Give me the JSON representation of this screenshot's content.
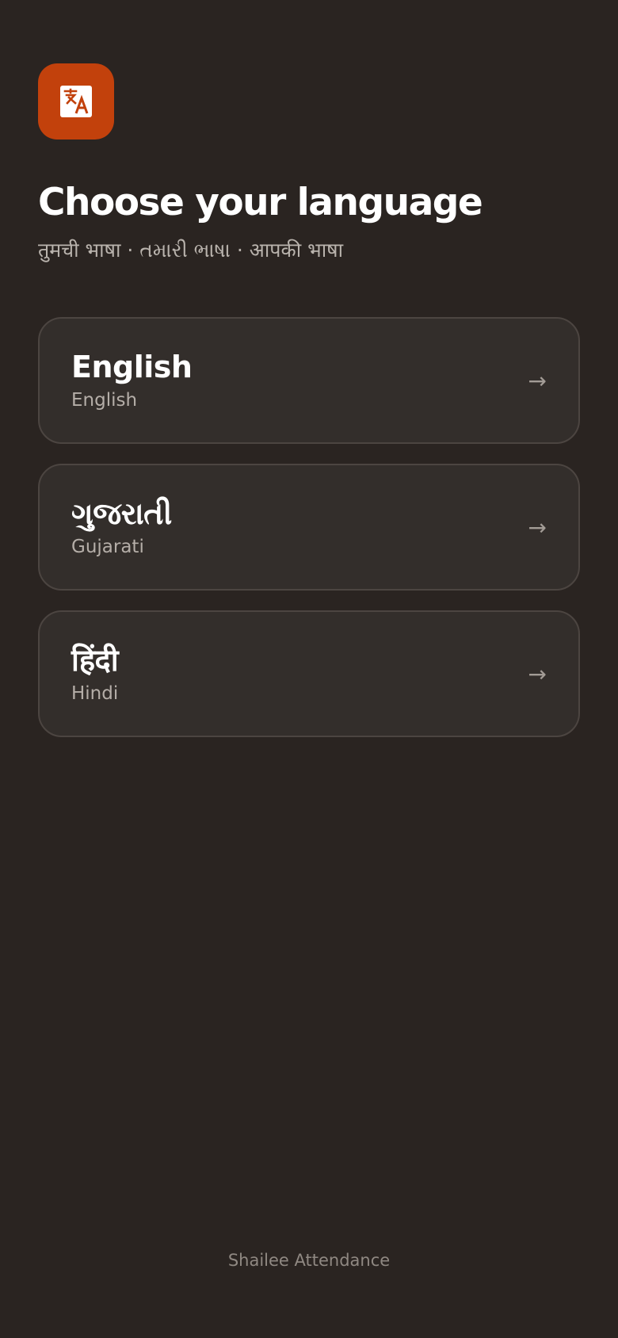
{
  "app": {
    "icon": "translate-icon",
    "accent_color": "#c2410c",
    "background_color": "#2a2421"
  },
  "header": {
    "title": "Choose your language",
    "subtitle": "तुमची भाषा · તમારી ભાષા · आपकी भाषा"
  },
  "languages": [
    {
      "native": "English",
      "english": "English",
      "arrow": "→"
    },
    {
      "native": "ગુજરાતી",
      "english": "Gujarati",
      "arrow": "→"
    },
    {
      "native": "हिंदी",
      "english": "Hindi",
      "arrow": "→"
    }
  ],
  "footer": {
    "brand": "Shailee Attendance"
  }
}
